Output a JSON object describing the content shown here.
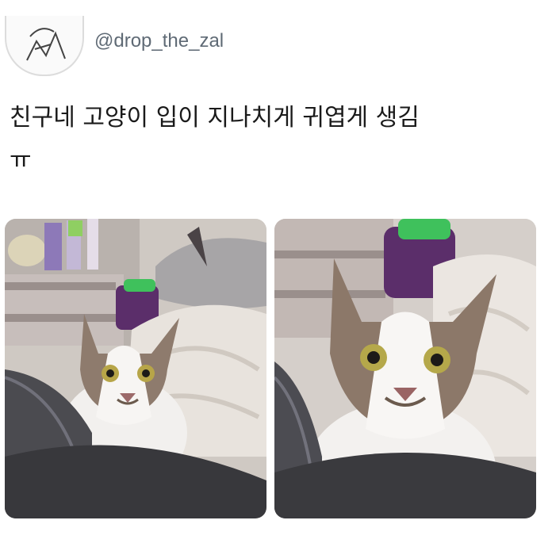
{
  "tweet": {
    "handle": "@drop_the_zal",
    "text_line1": "친구네 고양이 입이 지나치게 귀엽게 생김",
    "text_line2": "ㅠ"
  },
  "icons": {
    "avatar": "avatar-sketch-icon"
  },
  "colors": {
    "background": "#ffffff",
    "handle_text": "#5f6a75",
    "tweet_text": "#1a1a1a"
  }
}
